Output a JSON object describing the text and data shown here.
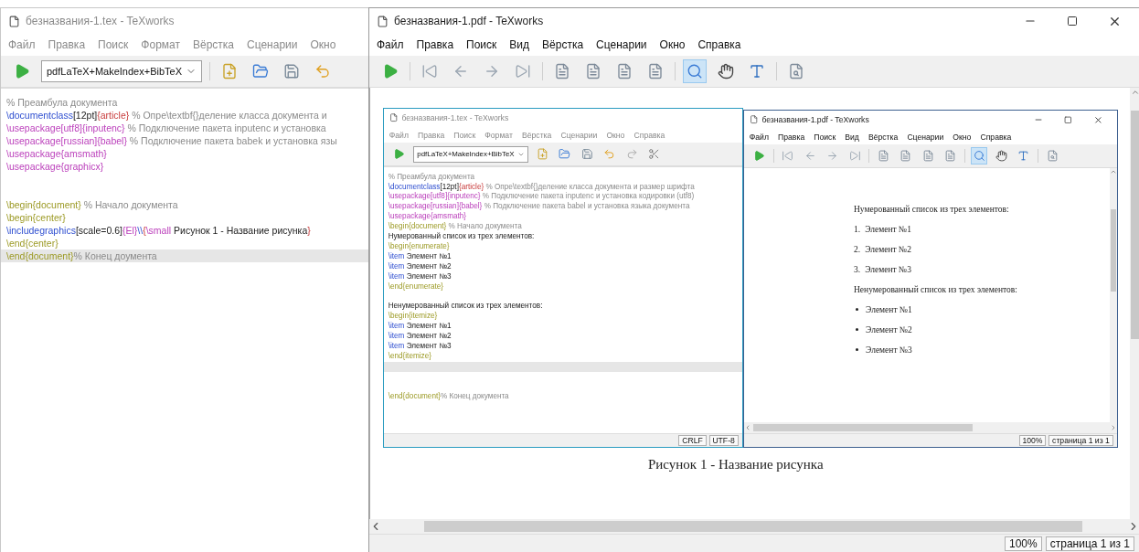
{
  "editor_window": {
    "title": "безназвания-1.tex - TeXworks",
    "menu": [
      "Файл",
      "Правка",
      "Поиск",
      "Формат",
      "Вёрстка",
      "Сценарии",
      "Окно"
    ],
    "toolbar": {
      "engine": "pdfLaTeX+MakeIndex+BibTeX",
      "tools": [
        {
          "kind": "new"
        },
        {
          "kind": "open"
        },
        {
          "kind": "save"
        },
        {
          "kind": "undo"
        }
      ]
    },
    "lines": [
      {
        "tokens": [
          {
            "text": "% Преамбула документа",
            "kind": "comment"
          }
        ],
        "current": false
      },
      {
        "tokens": [
          {
            "text": "\\documentclass",
            "kind": "command"
          },
          {
            "text": "[12pt]",
            "kind": "text"
          },
          {
            "text": "{article}",
            "kind": "brace"
          },
          {
            "text": " % Опре\\textbf{}деление класса документа и",
            "kind": "comment"
          }
        ],
        "current": false
      },
      {
        "tokens": [
          {
            "text": "\\usepackage[utf8]{inputenc}",
            "kind": "package"
          },
          {
            "text": " % Подключение пакета inputenc и установка",
            "kind": "comment"
          }
        ],
        "current": false
      },
      {
        "tokens": [
          {
            "text": "\\usepackage[russian]{babel}",
            "kind": "package"
          },
          {
            "text": " % Подключение пакета babek и установка язы",
            "kind": "comment"
          }
        ],
        "current": false
      },
      {
        "tokens": [
          {
            "text": "\\usepackage{amsmath}",
            "kind": "package"
          }
        ],
        "current": false
      },
      {
        "tokens": [
          {
            "text": "\\usepackage{graphicx}",
            "kind": "package"
          }
        ],
        "current": false
      },
      {
        "tokens": [
          {
            "text": "\\begin{document}",
            "kind": "env"
          },
          {
            "text": " % Начало документа",
            "kind": "comment"
          }
        ],
        "current": false,
        "kind": "double_spaced"
      },
      {
        "tokens": [
          {
            "text": "\\begin{center}",
            "kind": "env"
          }
        ],
        "current": false
      },
      {
        "tokens": [
          {
            "text": "\\includegraphics",
            "kind": "command"
          },
          {
            "text": "[scale=0.6]",
            "kind": "text"
          },
          {
            "text": "{El}",
            "kind": "package"
          },
          {
            "text": "\\\\",
            "kind": "command"
          },
          {
            "text": "{",
            "kind": "brace"
          },
          {
            "text": "\\small",
            "kind": "package"
          },
          {
            "text": " Рисунок 1 - Название рисунка",
            "kind": "text"
          },
          {
            "text": "}",
            "kind": "brace"
          }
        ],
        "current": false
      },
      {
        "tokens": [
          {
            "text": "\\end{center}",
            "kind": "env"
          }
        ],
        "current": false
      },
      {
        "tokens": [
          {
            "text": "\\end{document}",
            "kind": "env"
          },
          {
            "text": "% Конец доумента",
            "kind": "comment"
          }
        ],
        "current": true
      }
    ]
  },
  "viewer_window": {
    "title": "безназвания-1.pdf - TeXworks",
    "menu": [
      "Файл",
      "Правка",
      "Поиск",
      "Вид",
      "Вёрстка",
      "Сценарии",
      "Окно",
      "Справка"
    ],
    "tools": [
      {
        "kind": "typeset",
        "selected": false
      },
      {
        "kind": "first",
        "selected": false
      },
      {
        "kind": "prev",
        "selected": false
      },
      {
        "kind": "next",
        "selected": false
      },
      {
        "kind": "last",
        "selected": false
      },
      {
        "kind": "page",
        "selected": false
      },
      {
        "kind": "page",
        "selected": false
      },
      {
        "kind": "page",
        "selected": false
      },
      {
        "kind": "page",
        "selected": false
      },
      {
        "kind": "magnify",
        "selected": true
      },
      {
        "kind": "hand",
        "selected": false
      },
      {
        "kind": "select_text",
        "selected": false
      },
      {
        "kind": "find",
        "selected": false
      }
    ],
    "page": {
      "figure": {
        "editor": {
          "title": "безназвания-1.tex - TeXworks",
          "menu": [
            "Файл",
            "Правка",
            "Поиск",
            "Формат",
            "Вёрстка",
            "Сценарии",
            "Окно",
            "Справка"
          ],
          "engine": "pdfLaTeX+MakeIndex+BibTeX",
          "tools": [
            {
              "kind": "new"
            },
            {
              "kind": "open"
            },
            {
              "kind": "save"
            },
            {
              "kind": "undo"
            },
            {
              "kind": "redo"
            },
            {
              "kind": "cut"
            }
          ],
          "lines": [
            {
              "tokens": [
                {
                  "text": "% Преамбула документа",
                  "kind": "comment"
                }
              ],
              "current": false
            },
            {
              "tokens": [
                {
                  "text": "\\documentclass",
                  "kind": "command"
                },
                {
                  "text": "[12pt]",
                  "kind": "text"
                },
                {
                  "text": "{article}",
                  "kind": "brace"
                },
                {
                  "text": " % Опре\\textbf{}деление класса документа и размер шрифта",
                  "kind": "comment"
                }
              ],
              "current": false
            },
            {
              "tokens": [
                {
                  "text": "\\usepackage[utf8]{inputenc}",
                  "kind": "package"
                },
                {
                  "text": " % Подключение пакета inputenc и установка кодировки (utf8)",
                  "kind": "comment"
                }
              ],
              "current": false
            },
            {
              "tokens": [
                {
                  "text": "\\usepackage[russian]{babel}",
                  "kind": "package"
                },
                {
                  "text": " % Подключение пакета babel и установка языка документа",
                  "kind": "comment"
                }
              ],
              "current": false
            },
            {
              "tokens": [
                {
                  "text": "\\usepackage{amsmath}",
                  "kind": "package"
                }
              ],
              "current": false
            },
            {
              "tokens": [
                {
                  "text": "\\begin{document}",
                  "kind": "env"
                },
                {
                  "text": " % Начало документа",
                  "kind": "comment"
                }
              ],
              "current": false
            },
            {
              "tokens": [
                {
                  "text": "Нумерованный список из трех элементов:",
                  "kind": "text"
                }
              ],
              "current": false
            },
            {
              "tokens": [
                {
                  "text": "\\begin{enumerate}",
                  "kind": "env"
                }
              ],
              "current": false
            },
            {
              "tokens": [
                {
                  "text": "\\item",
                  "kind": "command"
                },
                {
                  "text": " Элемент №1",
                  "kind": "text"
                }
              ],
              "current": false
            },
            {
              "tokens": [
                {
                  "text": "\\item",
                  "kind": "command"
                },
                {
                  "text": " Элемент №2",
                  "kind": "text"
                }
              ],
              "current": false
            },
            {
              "tokens": [
                {
                  "text": "\\item",
                  "kind": "command"
                },
                {
                  "text": " Элемент №3",
                  "kind": "text"
                }
              ],
              "current": false
            },
            {
              "tokens": [
                {
                  "text": "\\end{enumerate}",
                  "kind": "env"
                }
              ],
              "current": false
            },
            {
              "tokens": [
                {
                  "text": "Ненумерованный список из трех элементов:",
                  "kind": "text"
                }
              ],
              "current": false,
              "kind": "spaced"
            },
            {
              "tokens": [
                {
                  "text": "\\begin{itemize}",
                  "kind": "env"
                }
              ],
              "current": false
            },
            {
              "tokens": [
                {
                  "text": "\\item",
                  "kind": "command"
                },
                {
                  "text": " Элемент №1",
                  "kind": "text"
                }
              ],
              "current": false
            },
            {
              "tokens": [
                {
                  "text": "\\item",
                  "kind": "command"
                },
                {
                  "text": " Элемент №2",
                  "kind": "text"
                }
              ],
              "current": false
            },
            {
              "tokens": [
                {
                  "text": "\\item",
                  "kind": "command"
                },
                {
                  "text": " Элемент №3",
                  "kind": "text"
                }
              ],
              "current": false
            },
            {
              "tokens": [
                {
                  "text": "\\end{itemize}",
                  "kind": "env"
                }
              ],
              "current": false
            },
            {
              "current": true
            },
            {
              "tokens": [
                {
                  "text": "\\end{document}",
                  "kind": "env"
                },
                {
                  "text": "% Конец документа",
                  "kind": "comment"
                }
              ],
              "current": false,
              "kind": "double_spaced"
            }
          ],
          "status": [
            "CRLF",
            "UTF-8"
          ]
        },
        "viewer": {
          "title": "безназвания-1.pdf - TeXworks",
          "menu": [
            "Файл",
            "Правка",
            "Поиск",
            "Вид",
            "Вёрстка",
            "Сценарии",
            "Окно",
            "Справка"
          ],
          "tools": [
            {
              "kind": "typeset",
              "selected": false
            },
            {
              "kind": "first",
              "selected": false
            },
            {
              "kind": "prev",
              "selected": false
            },
            {
              "kind": "next",
              "selected": false
            },
            {
              "kind": "last",
              "selected": false
            },
            {
              "kind": "page",
              "selected": false
            },
            {
              "kind": "page",
              "selected": false
            },
            {
              "kind": "page",
              "selected": false
            },
            {
              "kind": "page",
              "selected": false
            },
            {
              "kind": "magnify",
              "selected": true
            },
            {
              "kind": "hand",
              "selected": false
            },
            {
              "kind": "select_text",
              "selected": false
            },
            {
              "kind": "find",
              "selected": false
            }
          ],
          "items": [
            {
              "kind": "heading",
              "text": "Нумерованный список из трех элементов:"
            },
            {
              "kind": "numbered",
              "marker": "1.",
              "text": "Элемент №1"
            },
            {
              "kind": "numbered",
              "marker": "2.",
              "text": "Элемент №2"
            },
            {
              "kind": "numbered",
              "marker": "3.",
              "text": "Элемент №3"
            },
            {
              "kind": "heading",
              "text": "Ненумерованный список из трех элементов:"
            },
            {
              "kind": "bullet",
              "text": "Элемент №1"
            },
            {
              "kind": "bullet",
              "text": "Элемент №2"
            },
            {
              "kind": "bullet",
              "text": "Элемент №3"
            }
          ],
          "status": {
            "zoom": "100%",
            "page": "страница 1 из 1"
          }
        }
      },
      "caption": "Рисунок 1 - Название рисунка"
    },
    "status": {
      "zoom": "100%",
      "page": "страница 1 из 1"
    }
  }
}
